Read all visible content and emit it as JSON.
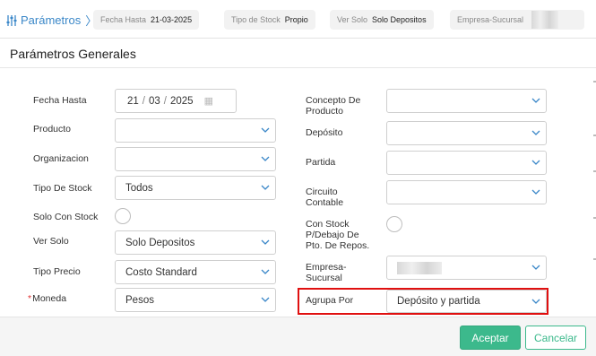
{
  "topbar": {
    "title": "Parámetros",
    "chevron": "〉",
    "icon": "sliders-icon",
    "chips": [
      {
        "key": "Fecha Hasta",
        "value": "21-03-2025"
      },
      {
        "key": "Tipo de Stock",
        "value": "Propio"
      },
      {
        "key": "Ver Solo",
        "value": "Solo Depositos"
      },
      {
        "key": "Empresa-Sucursal",
        "value": ""
      }
    ]
  },
  "modal": {
    "title": "Parámetros Generales",
    "left": {
      "fecha_hasta": {
        "label": "Fecha Hasta",
        "day": "21",
        "month": "03",
        "year": "2025"
      },
      "producto": {
        "label": "Producto",
        "value": ""
      },
      "organizacion": {
        "label": "Organizacion",
        "value": ""
      },
      "tipo_stock": {
        "label": "Tipo De Stock",
        "value": "Todos"
      },
      "solo_con_stock": {
        "label": "Solo Con Stock",
        "checked": false
      },
      "ver_solo": {
        "label": "Ver Solo",
        "value": "Solo Depositos"
      },
      "tipo_precio": {
        "label": "Tipo Precio",
        "value": "Costo Standard"
      },
      "moneda": {
        "label": "Moneda",
        "required_mark": "*",
        "value": "Pesos"
      }
    },
    "right": {
      "concepto_producto": {
        "label": "Concepto De Producto",
        "value": ""
      },
      "deposito": {
        "label": "Depósito",
        "value": ""
      },
      "partida": {
        "label": "Partida",
        "value": ""
      },
      "circuito_contable": {
        "label": "Circuito Contable",
        "value": ""
      },
      "con_stock_debajo": {
        "label": "Con Stock P/Debajo De Pto. De Repos.",
        "checked": false
      },
      "empresa_sucursal": {
        "label": "Empresa-Sucursal",
        "value": ""
      },
      "agrupa_por": {
        "label": "Agrupa Por",
        "value": "Depósito y partida"
      }
    },
    "buttons": {
      "accept": "Aceptar",
      "cancel": "Cancelar"
    },
    "colors": {
      "accent": "#3cb98c",
      "link": "#3a87c8",
      "highlight": "#e01010",
      "required": "#e03030"
    }
  }
}
